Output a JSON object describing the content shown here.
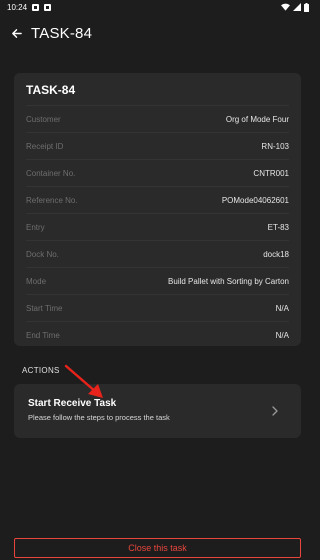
{
  "status_bar": {
    "time": "10:24"
  },
  "header": {
    "title": "TASK-84"
  },
  "card": {
    "title": "TASK-84",
    "rows": [
      {
        "label": "Customer",
        "value": "Org of Mode Four"
      },
      {
        "label": "Receipt ID",
        "value": "RN-103"
      },
      {
        "label": "Container No.",
        "value": "CNTR001"
      },
      {
        "label": "Reference No.",
        "value": "POMode04062601"
      },
      {
        "label": "Entry",
        "value": "ET-83"
      },
      {
        "label": "Dock No.",
        "value": "dock18"
      },
      {
        "label": "Mode",
        "value": "Build Pallet with Sorting by Carton"
      },
      {
        "label": "Start Time",
        "value": "N/A"
      },
      {
        "label": "End Time",
        "value": "N/A"
      }
    ]
  },
  "actions": {
    "section_label": "ACTIONS",
    "items": [
      {
        "title": "Start Receive Task",
        "subtitle": "Please follow the steps to process the task"
      }
    ]
  },
  "footer": {
    "close_label": "Close this task"
  },
  "colors": {
    "background": "#1d1d1d",
    "card": "#2a2a2a",
    "danger": "#e8453c",
    "annotation": "#e8231c"
  },
  "icons": [
    "back-arrow-icon",
    "chevron-right-icon",
    "wifi-icon",
    "signal-icon",
    "battery-icon"
  ]
}
